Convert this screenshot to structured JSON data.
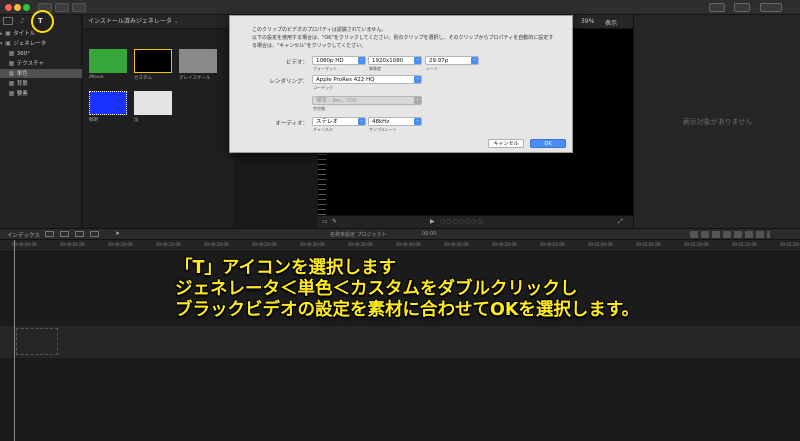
{
  "toolbar": {
    "traffic_colors": [
      "#fe5f57",
      "#febc2e",
      "#28c840"
    ]
  },
  "sidebar": {
    "items": [
      {
        "label": "タイトル",
        "icon": "title-icon",
        "arrow": "▸"
      },
      {
        "label": "ジェネレータ",
        "icon": "generator-icon",
        "arrow": "▾"
      },
      {
        "label": "360°",
        "icon": "grid-icon"
      },
      {
        "label": "テクスチャ",
        "icon": "grid-icon"
      },
      {
        "label": "単色",
        "icon": "grid-icon",
        "selected": true
      },
      {
        "label": "背景",
        "icon": "grid-icon"
      },
      {
        "label": "要素",
        "icon": "grid-icon"
      }
    ]
  },
  "browser": {
    "header": "インストール済みジェネレータ",
    "thumbs": [
      {
        "label": "iMovie",
        "color": "#36a83b"
      },
      {
        "label": "カスタム",
        "color": "#000000",
        "selected": true
      },
      {
        "label": "グレイスケール",
        "color": "#8a8a8a"
      },
      {
        "label": "鮮明",
        "color": "#1a32ff"
      },
      {
        "label": "淡",
        "color": "#e4e4e4"
      }
    ]
  },
  "viewer": {
    "zoom": "39%",
    "view_label": "表示"
  },
  "inspector": {
    "empty_text": "表示対象がありません"
  },
  "timeline": {
    "index_label": "インデックス",
    "project_name": "名称未設定 プロジェクト",
    "project_time": "00:00",
    "ruler_ticks": [
      "00:00:00:00",
      "00:00:05:00",
      "00:00:10:00",
      "00:00:15:00",
      "00:00:20:00",
      "00:00:25:00",
      "00:00:30:00",
      "00:00:35:00",
      "00:00:40:00",
      "00:00:45:00",
      "00:00:50:00",
      "00:00:55:00",
      "00:01:00:00",
      "00:01:05:00",
      "00:01:10:00",
      "00:01:15:00",
      "00:01:20:00"
    ]
  },
  "dialog": {
    "msg1": "このクリップのビデオのプロパティは認識されていません。",
    "msg2": "以下の設定を使用する場合は、\"OK\"をクリックしてください。別のクリップを選択し、そのクリップからプロパティを自動的に設定す",
    "msg3": "る場合は、\"キャンセル\"をクリックしてください。",
    "video_label": "ビデオ：",
    "format_value": "1080p HD",
    "format_sub": "フォーマット",
    "resolution_value": "1920x1080",
    "resolution_sub": "解像度",
    "rate_value": "29.97p",
    "rate_sub": "レート",
    "rendering_label": "レンダリング：",
    "codec_value": "Apple ProRes 422 HQ",
    "codec_sub": "コーデック",
    "colorspace_value": "標準 - Rec. 709",
    "colorspace_sub": "色空間",
    "audio_label": "オーディオ：",
    "channels_value": "ステレオ",
    "channels_sub": "チャンネル",
    "samplerate_value": "48kHz",
    "samplerate_sub": "サンプルレート",
    "cancel_label": "キャンセル",
    "ok_label": "OK"
  },
  "caption": {
    "line1": "「T」アイコンを選択します",
    "line2": "ジェネレータ＜単色＜カスタムをダブルクリックし",
    "line3": "ブラックビデオの設定を素材に合わせてOKを選択します。"
  },
  "accent_colors": {
    "highlight": "#ffe400",
    "caption": "#ffec1a",
    "ok_button": "#4a8df7"
  }
}
